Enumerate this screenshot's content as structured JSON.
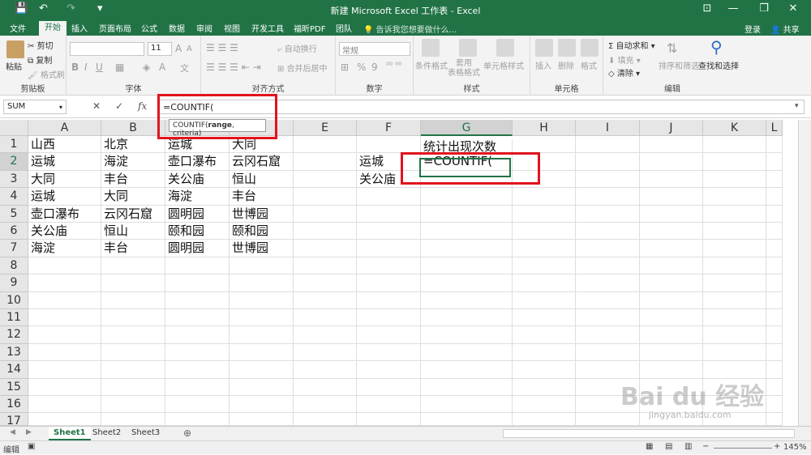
{
  "window": {
    "title": "新建 Microsoft Excel 工作表 - Excel",
    "save_icon": "💾",
    "undo_icon": "↶",
    "redo_icon": "↷",
    "customize_icon": "▾",
    "ribbon_toggle": "⊡",
    "minimize": "—",
    "restore": "❐",
    "close": "✕"
  },
  "tabs": [
    "文件",
    "开始",
    "插入",
    "页面布局",
    "公式",
    "数据",
    "审阅",
    "视图",
    "开发工具",
    "福昕PDF",
    "团队"
  ],
  "active_tab": "开始",
  "tell_me": "告诉我您想要做什么...",
  "login": "登录",
  "share": "共享",
  "ribbon": {
    "clipboard": {
      "label": "剪贴板",
      "paste": "粘贴",
      "cut": "剪切",
      "copy": "复制",
      "format_painter": "格式刷"
    },
    "font": {
      "label": "字体",
      "font_name": "",
      "font_size": "11",
      "grow": "A",
      "shrink": "A",
      "bold": "B",
      "italic": "I",
      "underline": "U",
      "font_color": "A",
      "phonetic": "文"
    },
    "alignment": {
      "label": "对齐方式",
      "wrap_text": "自动换行",
      "merge_center": "合并后居中"
    },
    "number": {
      "label": "数字",
      "format": "常规",
      "percent": "%",
      "comma": "9"
    },
    "styles": {
      "label": "样式",
      "conditional": "条件格式",
      "table": "套用\n表格格式",
      "cell_styles": "单元格样式"
    },
    "cells": {
      "label": "单元格",
      "insert": "插入",
      "delete": "删除",
      "format": "格式"
    },
    "editing": {
      "label": "编辑",
      "autosum": "自动求和",
      "fill": "填充",
      "clear": "清除",
      "sort_filter": "排序和筛选",
      "find_select": "查找和选择"
    }
  },
  "formula_bar": {
    "name_box": "SUM",
    "cancel": "✕",
    "enter": "✓",
    "fx": "fx",
    "formula": "=COUNTIF(",
    "tooltip_fn": "COUNTIF(",
    "tooltip_arg1": "range",
    "tooltip_rest": ", criteria)"
  },
  "columns": [
    "A",
    "B",
    "C",
    "D",
    "E",
    "F",
    "G",
    "H",
    "I",
    "J",
    "K",
    "L"
  ],
  "rows": [
    "1",
    "2",
    "3",
    "4",
    "5",
    "6",
    "7",
    "8",
    "9",
    "10",
    "11",
    "12",
    "13",
    "14",
    "15",
    "16",
    "17"
  ],
  "cells": {
    "A1": "山西",
    "B1": "北京",
    "C1": "运城",
    "D1": "大同",
    "G1": "统计出现次数",
    "A2": "运城",
    "B2": "海淀",
    "C2": "壶口瀑布",
    "D2": "云冈石窟",
    "F2": "运城",
    "G2": "=COUNTIF(",
    "A3": "大同",
    "B3": "丰台",
    "C3": "关公庙",
    "D3": "恒山",
    "F3": "关公庙",
    "A4": "运城",
    "B4": "大同",
    "C4": "海淀",
    "D4": "丰台",
    "A5": "壶口瀑布",
    "B5": "云冈石窟",
    "C5": "圆明园",
    "D5": "世博园",
    "A6": "关公庙",
    "B6": "恒山",
    "C6": "颐和园",
    "D6": "颐和园",
    "A7": "海淀",
    "B7": "丰台",
    "C7": "圆明园",
    "D7": "世博园"
  },
  "sheets": [
    "Sheet1",
    "Sheet2",
    "Sheet3"
  ],
  "active_sheet": "Sheet1",
  "add_sheet": "⊕",
  "status": {
    "mode": "编辑",
    "zoom": "145%"
  },
  "watermark": {
    "main": "Bai du 经验",
    "sub": "jingyan.baidu.com"
  }
}
